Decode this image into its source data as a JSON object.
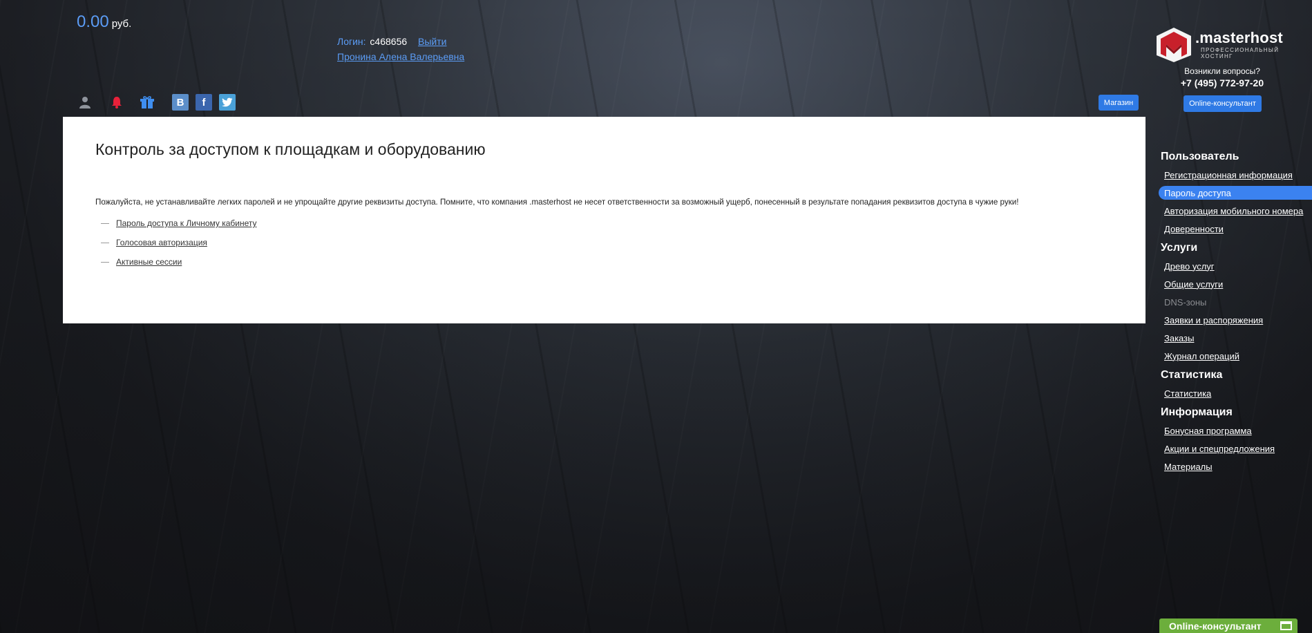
{
  "header": {
    "balance_amount": "0.00",
    "balance_currency": "руб.",
    "login_label": "Логин:",
    "login_value": "c468656",
    "logout_label": "Выйти",
    "user_name": "Пронина Алена Валерьевна",
    "social": {
      "vk": "B",
      "facebook": "f"
    },
    "shop_label": "Магазин"
  },
  "brand": {
    "name": ".masterhost",
    "tagline": "профессиональный хостинг",
    "question": "Возникли вопросы?",
    "phone": "+7 (495) 772-97-20",
    "consultant_label": "Online-консультант"
  },
  "main": {
    "title": "Контроль за доступом к площадкам и оборудованию",
    "notice": "Пожалуйста, не устанавливайте легких паролей и не упрощайте другие реквизиты доступа. Помните, что компания .masterhost не несет ответственности за возможный ущерб, понесенный в результате попадания реквизитов доступа в чужие руки!",
    "links": [
      "Пароль доступа к Личному кабинету",
      "Голосовая авторизация",
      "Активные сессии"
    ]
  },
  "sidebar": {
    "groups": [
      {
        "heading": "Пользователь",
        "items": [
          {
            "label": "Регистрационная информация"
          },
          {
            "label": "Пароль доступа",
            "active": true
          },
          {
            "label": "Авторизация мобильного номера"
          },
          {
            "label": "Доверенности"
          }
        ]
      },
      {
        "heading": "Услуги",
        "items": [
          {
            "label": "Древо услуг"
          },
          {
            "label": "Общие услуги"
          },
          {
            "label": "DNS-зоны",
            "disabled": true
          },
          {
            "label": "Заявки и распоряжения"
          },
          {
            "label": "Заказы"
          },
          {
            "label": "Журнал операций"
          }
        ]
      },
      {
        "heading": "Статистика",
        "items": [
          {
            "label": "Статистика"
          }
        ]
      },
      {
        "heading": "Информация",
        "items": [
          {
            "label": "Бонусная программа"
          },
          {
            "label": "Акции и спецпредложения"
          },
          {
            "label": "Материалы"
          }
        ]
      }
    ]
  },
  "chat_widget": {
    "label": "Online-консультант"
  },
  "colors": {
    "accent": "#2f7ae5",
    "link": "#5b9cf5",
    "active_item": "#3b82f0",
    "chat_green": "#6cae3c"
  }
}
